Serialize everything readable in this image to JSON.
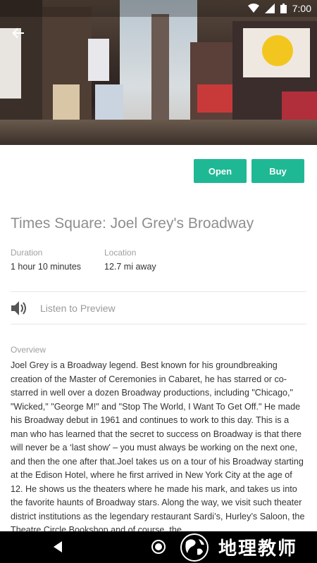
{
  "status_bar": {
    "time": "7:00"
  },
  "hero": {
    "image": "Times Square street scene"
  },
  "actions": {
    "open_label": "Open",
    "buy_label": "Buy",
    "accent_color": "#1fb894"
  },
  "tour": {
    "title": "Times Square: Joel Grey's Broadway",
    "duration_label": "Duration",
    "duration_value": "1 hour 10 minutes",
    "location_label": "Location",
    "location_value": "12.7 mi away",
    "preview_label": "Listen to Preview",
    "overview_label": "Overview",
    "overview_text": "Joel Grey is a Broadway legend. Best known for his groundbreaking creation of the Master of Ceremonies in Cabaret, he has starred or co-starred in well over a dozen Broadway productions, including \"Chicago,\" \"Wicked,\" \"George M!\" and \"Stop The World, I Want To Get Off.\" He made his Broadway debut in 1961 and continues to work to this day. This is a man who has learned that the secret to success on Broadway is that there will never be a ‘last show’ – you must always be working on the next one, and then the one after that.Joel takes us on a tour of his Broadway starting at the Edison Hotel, where he first arrived in New York City at the age of 12. He shows us the theaters where he made his mark, and takes us into the favorite haunts of Broadway stars. Along the way, we visit such theater district institutions as the legendary restaurant Sardi’s, Hurley’s Saloon, the Theatre Circle Bookshop and of course, the"
  },
  "watermark": {
    "text": "地理教师"
  }
}
